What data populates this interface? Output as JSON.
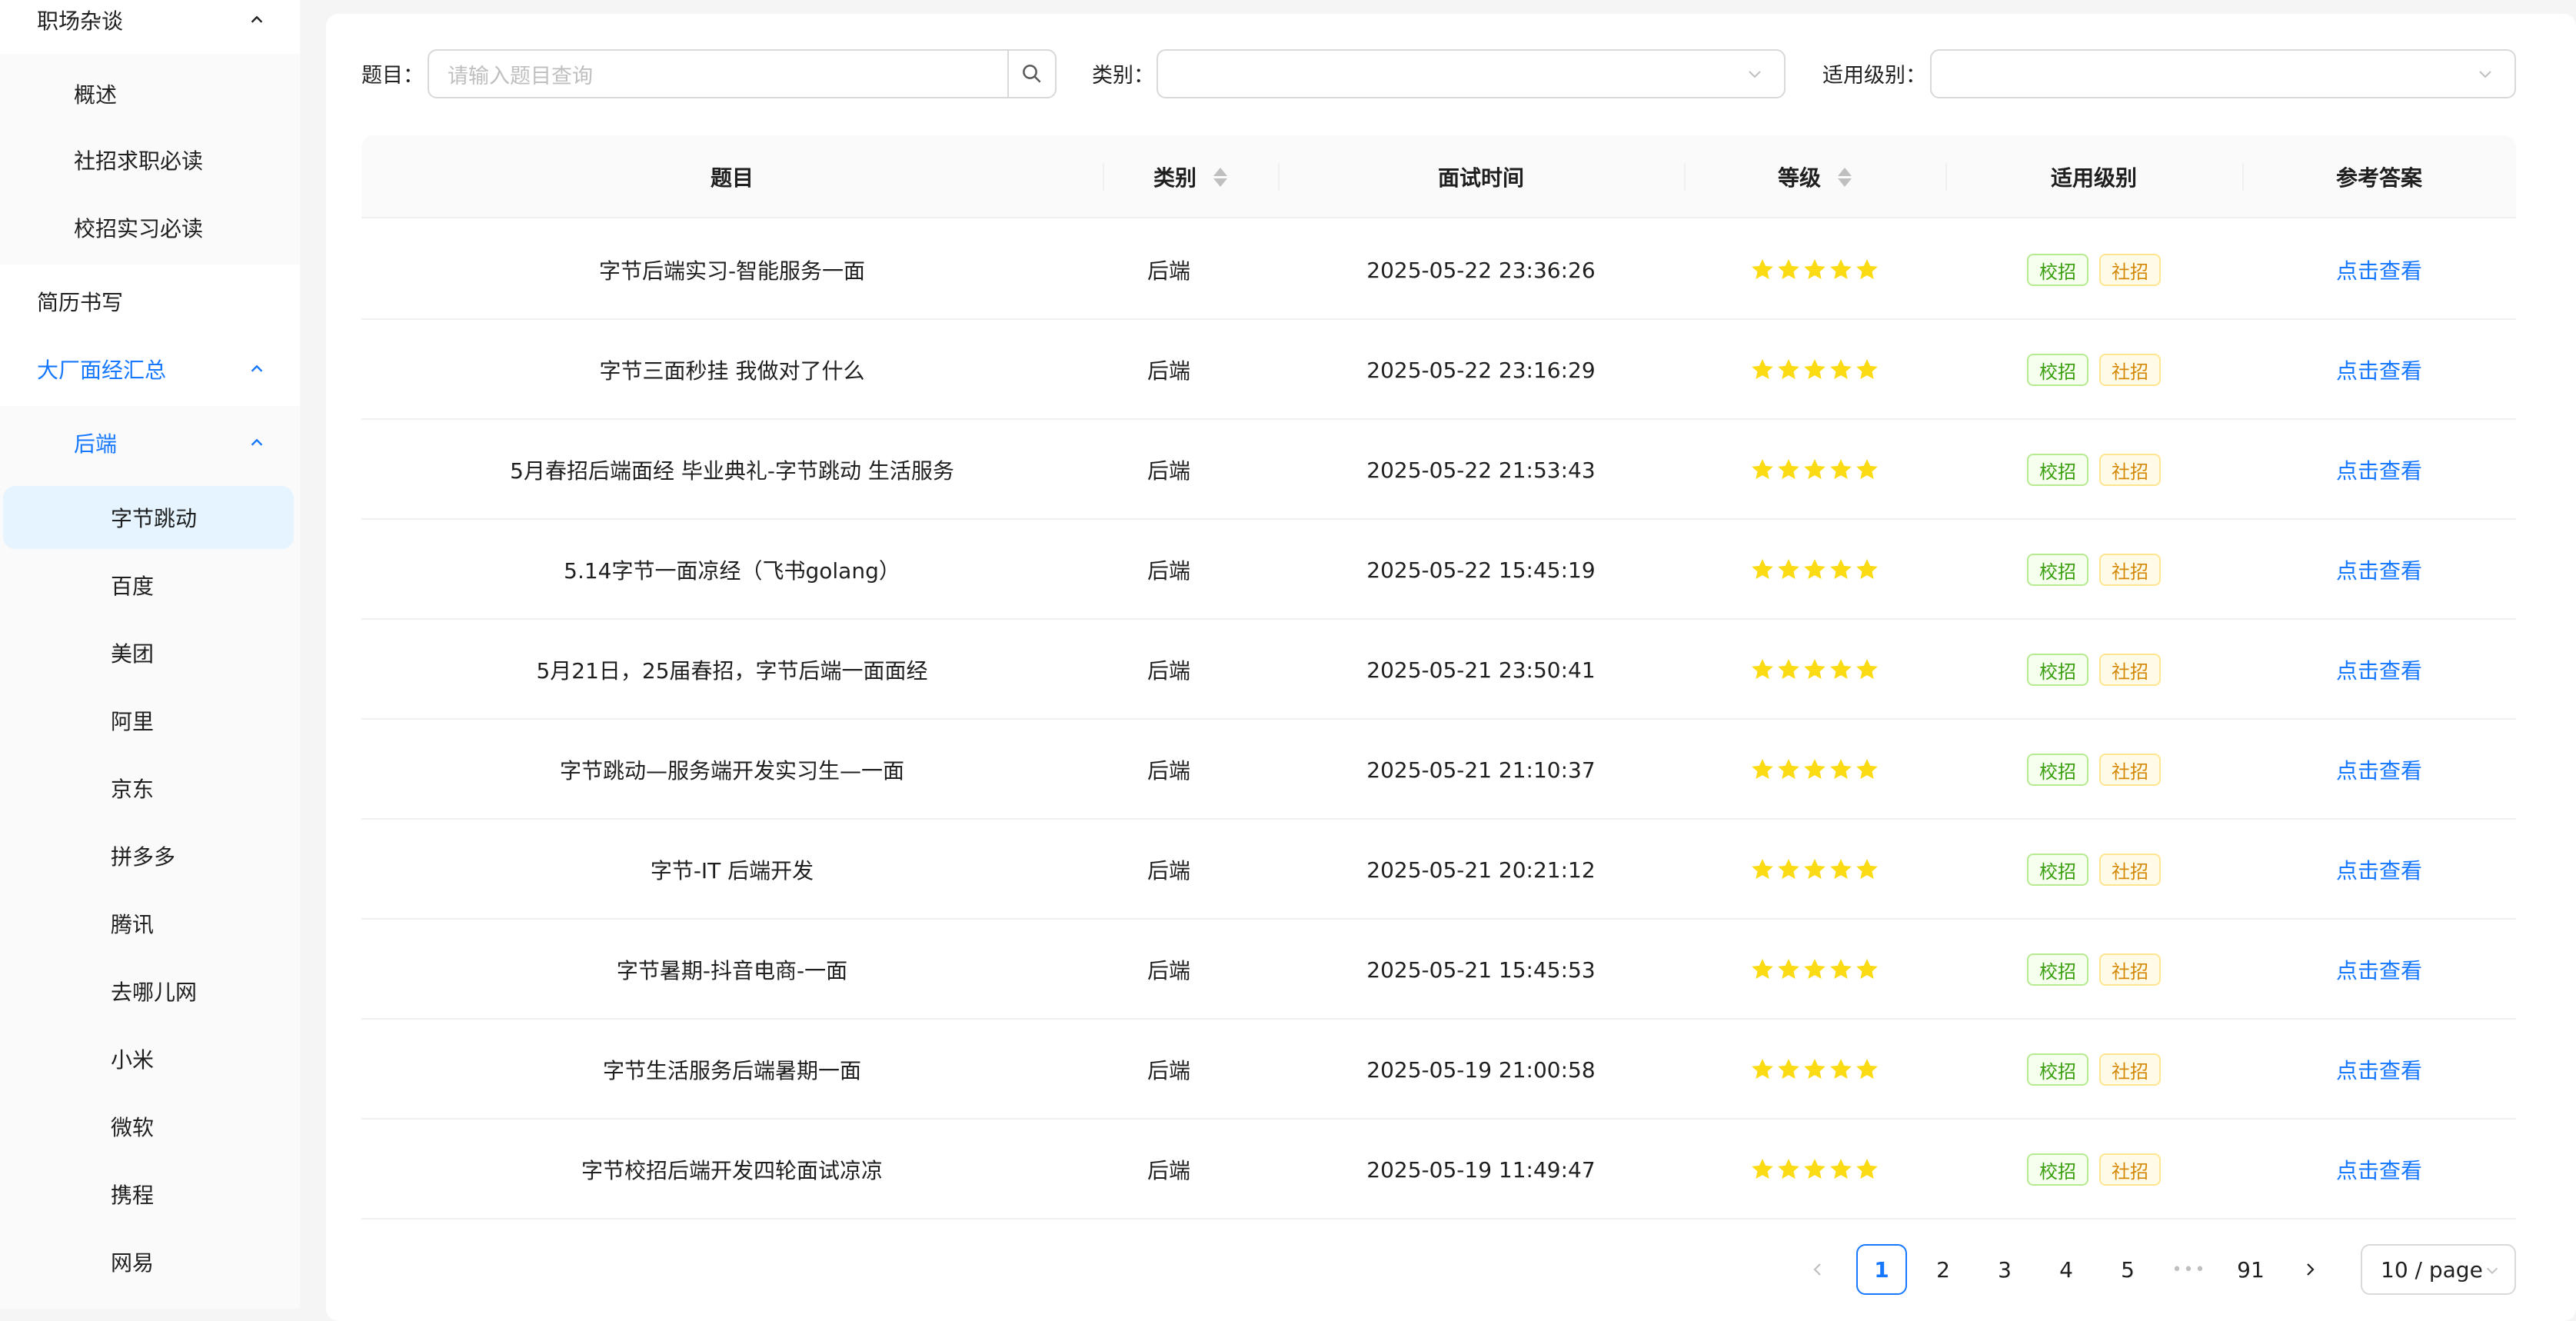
{
  "sidebar": {
    "items": [
      {
        "label": "职场杂谈"
      },
      {
        "label": "概述"
      },
      {
        "label": "社招求职必读"
      },
      {
        "label": "校招实习必读"
      },
      {
        "label": "简历书写"
      },
      {
        "label": "大厂面经汇总"
      },
      {
        "label": "后端"
      }
    ],
    "companies": [
      "字节跳动",
      "百度",
      "美团",
      "阿里",
      "京东",
      "拼多多",
      "腾讯",
      "去哪儿网",
      "小米",
      "微软",
      "携程",
      "网易"
    ]
  },
  "filters": {
    "title_label": "题目：",
    "title_placeholder": "请输入题目查询",
    "category_label": "类别：",
    "level_label": "适用级别："
  },
  "table": {
    "headers": [
      "题目",
      "类别",
      "面试时间",
      "等级",
      "适用级别",
      "参考答案"
    ],
    "tag_campus": "校招",
    "tag_social": "社招",
    "link_label": "点击查看",
    "rows": [
      {
        "title": "字节后端实习-智能服务一面",
        "category": "后端",
        "time": "2025-05-22 23:36:26",
        "stars": 5
      },
      {
        "title": "字节三面秒挂 我做对了什么",
        "category": "后端",
        "time": "2025-05-22 23:16:29",
        "stars": 5
      },
      {
        "title": "5月春招后端面经 毕业典礼-字节跳动 生活服务",
        "category": "后端",
        "time": "2025-05-22 21:53:43",
        "stars": 5
      },
      {
        "title": "5.14字节一面凉经（飞书golang）",
        "category": "后端",
        "time": "2025-05-22 15:45:19",
        "stars": 5
      },
      {
        "title": "5月21日，25届春招，字节后端一面面经",
        "category": "后端",
        "time": "2025-05-21 23:50:41",
        "stars": 5
      },
      {
        "title": "字节跳动—服务端开发实习生—一面",
        "category": "后端",
        "time": "2025-05-21 21:10:37",
        "stars": 5
      },
      {
        "title": "字节-IT 后端开发",
        "category": "后端",
        "time": "2025-05-21 20:21:12",
        "stars": 5
      },
      {
        "title": "字节暑期-抖音电商-一面",
        "category": "后端",
        "time": "2025-05-21 15:45:53",
        "stars": 5
      },
      {
        "title": "字节生活服务后端暑期一面",
        "category": "后端",
        "time": "2025-05-19 21:00:58",
        "stars": 5
      },
      {
        "title": "字节校招后端开发四轮面试凉凉",
        "category": "后端",
        "time": "2025-05-19 11:49:47",
        "stars": 5
      }
    ]
  },
  "pagination": {
    "pages": [
      "1",
      "2",
      "3",
      "4",
      "5"
    ],
    "ellipsis": "•••",
    "last": "91",
    "current": "1",
    "page_size": "10 / page"
  },
  "colors": {
    "accent": "#1677ff",
    "star": "#fadb14"
  }
}
